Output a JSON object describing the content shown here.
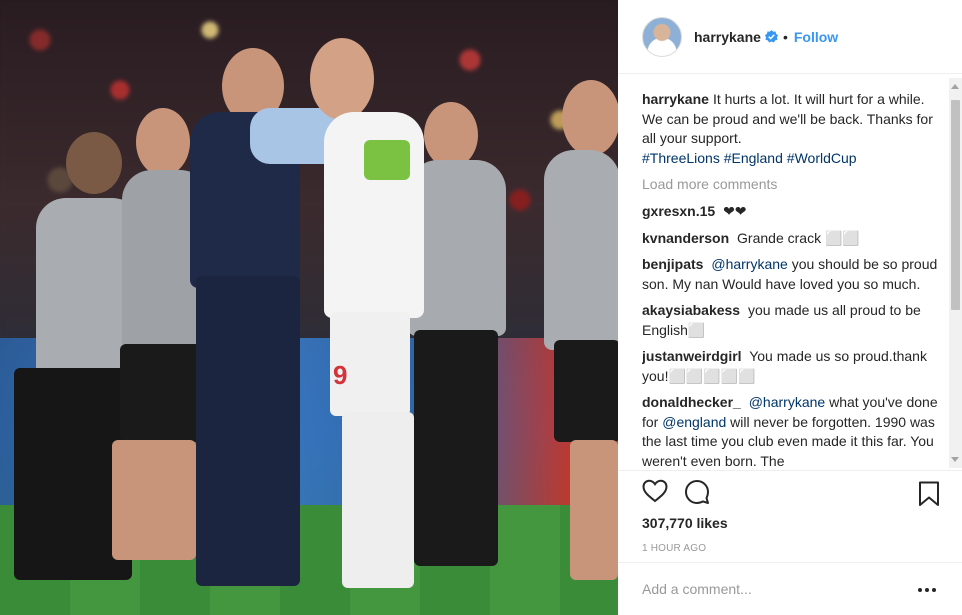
{
  "post": {
    "username": "harrykane",
    "follow_label": "Follow",
    "separator": "•",
    "caption_user": "harrykane",
    "caption_text": "It hurts a lot. It will hurt for a while. We can be proud and we'll be back. Thanks for all your support.",
    "hashtags": [
      "#ThreeLions",
      "#England",
      "#WorldCup"
    ],
    "load_more": "Load more comments",
    "comments": [
      {
        "user": "gxresxn.15",
        "text": "❤❤"
      },
      {
        "user": "kvnanderson",
        "text": "Grande crack ⬜⬜"
      },
      {
        "user": "benjipats",
        "mention": "@harrykane",
        "text": "you should be so proud son. My nan Would have loved you so much."
      },
      {
        "user": "akaysiabakess",
        "text": "you made us all proud to be English⬜"
      },
      {
        "user": "justanweirdgirl",
        "text": "You made us so proud.thank you!⬜⬜⬜⬜⬜"
      },
      {
        "user": "donaldhecker_",
        "mention": "@harrykane",
        "text_a": "what you've done for",
        "mention2": "@england",
        "text_b": "will never be forgotten. 1990 was the last time you club even made it this far. You weren't even born. The"
      }
    ],
    "likes": "307,770 likes",
    "time": "1 HOUR AGO",
    "comment_placeholder": "Add a comment..."
  },
  "photo": {
    "shirt_number": "9"
  },
  "colors": {
    "link": "#003569",
    "follow": "#3897f0",
    "verified": "#3897f0",
    "muted": "#999999"
  },
  "icons": [
    "verified-badge-icon",
    "heart-icon",
    "comment-icon",
    "bookmark-icon",
    "more-options-icon"
  ]
}
